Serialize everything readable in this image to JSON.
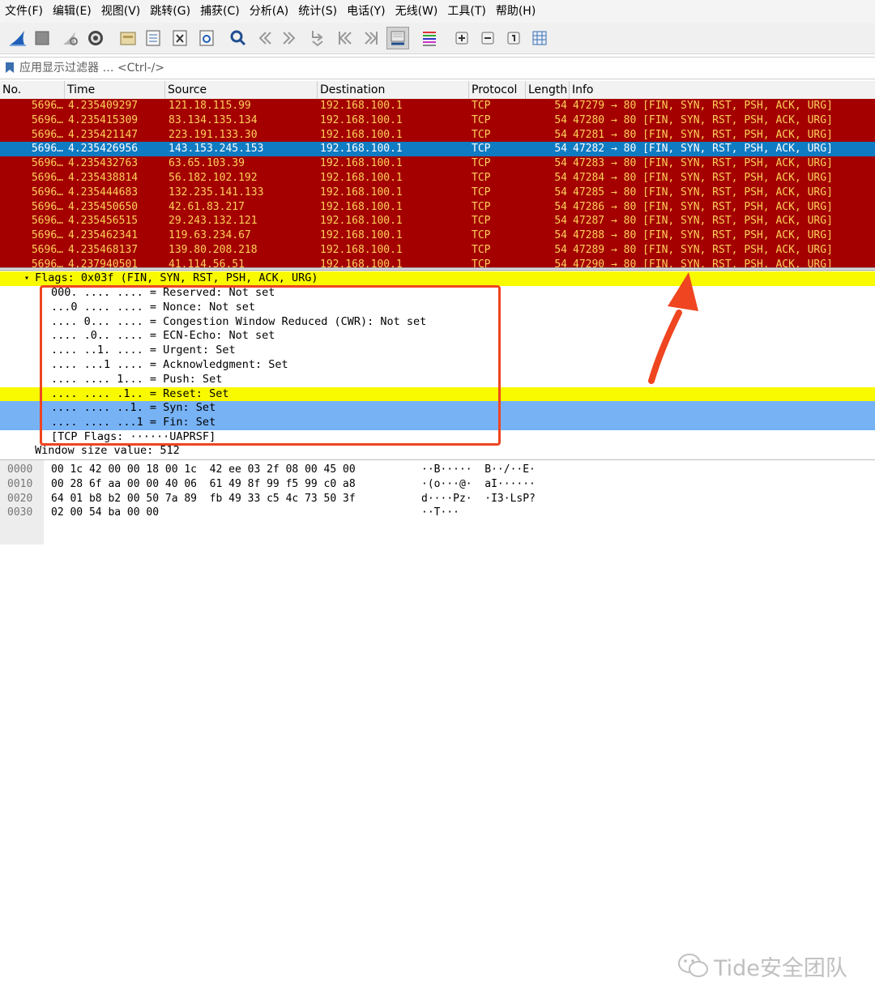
{
  "menu": [
    "文件(F)",
    "编辑(E)",
    "视图(V)",
    "跳转(G)",
    "捕获(C)",
    "分析(A)",
    "统计(S)",
    "电话(Y)",
    "无线(W)",
    "工具(T)",
    "帮助(H)"
  ],
  "filter": {
    "placeholder": "应用显示过滤器 … <Ctrl-/>"
  },
  "columns": [
    "No.",
    "Time",
    "Source",
    "Destination",
    "Protocol",
    "Length",
    "Info"
  ],
  "packets": [
    {
      "no": "5696…",
      "time": "4.235409297",
      "src": "121.18.115.99",
      "dst": "192.168.100.1",
      "proto": "TCP",
      "len": "54",
      "info": "47279 → 80 [FIN, SYN, RST, PSH, ACK, URG]"
    },
    {
      "no": "5696…",
      "time": "4.235415309",
      "src": "83.134.135.134",
      "dst": "192.168.100.1",
      "proto": "TCP",
      "len": "54",
      "info": "47280 → 80 [FIN, SYN, RST, PSH, ACK, URG]"
    },
    {
      "no": "5696…",
      "time": "4.235421147",
      "src": "223.191.133.30",
      "dst": "192.168.100.1",
      "proto": "TCP",
      "len": "54",
      "info": "47281 → 80 [FIN, SYN, RST, PSH, ACK, URG]"
    },
    {
      "no": "5696…",
      "time": "4.235426956",
      "src": "143.153.245.153",
      "dst": "192.168.100.1",
      "proto": "TCP",
      "len": "54",
      "info": "47282 → 80 [FIN, SYN, RST, PSH, ACK, URG]",
      "selected": true
    },
    {
      "no": "5696…",
      "time": "4.235432763",
      "src": "63.65.103.39",
      "dst": "192.168.100.1",
      "proto": "TCP",
      "len": "54",
      "info": "47283 → 80 [FIN, SYN, RST, PSH, ACK, URG]"
    },
    {
      "no": "5696…",
      "time": "4.235438814",
      "src": "56.182.102.192",
      "dst": "192.168.100.1",
      "proto": "TCP",
      "len": "54",
      "info": "47284 → 80 [FIN, SYN, RST, PSH, ACK, URG]"
    },
    {
      "no": "5696…",
      "time": "4.235444683",
      "src": "132.235.141.133",
      "dst": "192.168.100.1",
      "proto": "TCP",
      "len": "54",
      "info": "47285 → 80 [FIN, SYN, RST, PSH, ACK, URG]"
    },
    {
      "no": "5696…",
      "time": "4.235450650",
      "src": "42.61.83.217",
      "dst": "192.168.100.1",
      "proto": "TCP",
      "len": "54",
      "info": "47286 → 80 [FIN, SYN, RST, PSH, ACK, URG]"
    },
    {
      "no": "5696…",
      "time": "4.235456515",
      "src": "29.243.132.121",
      "dst": "192.168.100.1",
      "proto": "TCP",
      "len": "54",
      "info": "47287 → 80 [FIN, SYN, RST, PSH, ACK, URG]"
    },
    {
      "no": "5696…",
      "time": "4.235462341",
      "src": "119.63.234.67",
      "dst": "192.168.100.1",
      "proto": "TCP",
      "len": "54",
      "info": "47288 → 80 [FIN, SYN, RST, PSH, ACK, URG]"
    },
    {
      "no": "5696…",
      "time": "4.235468137",
      "src": "139.80.208.218",
      "dst": "192.168.100.1",
      "proto": "TCP",
      "len": "54",
      "info": "47289 → 80 [FIN, SYN, RST, PSH, ACK, URG]"
    },
    {
      "no": "5696…",
      "time": "4.237940501",
      "src": "41.114.56.51",
      "dst": "192.168.100.1",
      "proto": "TCP",
      "len": "54",
      "info": "47290 → 80 [FIN, SYN, RST, PSH, ACK, URG]"
    }
  ],
  "details": {
    "flags_header": "Flags: 0x03f (FIN, SYN, RST, PSH, ACK, URG)",
    "flag_lines": [
      {
        "text": "000. .... .... = Reserved: Not set"
      },
      {
        "text": "...0 .... .... = Nonce: Not set"
      },
      {
        "text": ".... 0... .... = Congestion Window Reduced (CWR): Not set"
      },
      {
        "text": ".... .0.. .... = ECN-Echo: Not set"
      },
      {
        "text": ".... ..1. .... = Urgent: Set"
      },
      {
        "text": ".... ...1 .... = Acknowledgment: Set"
      },
      {
        "text": ".... .... 1... = Push: Set"
      },
      {
        "text": ".... .... .1.. = Reset: Set",
        "highlight": "yellow"
      },
      {
        "text": ".... .... ..1. = Syn: Set",
        "highlight": "blue"
      },
      {
        "text": ".... .... ...1 = Fin: Set",
        "highlight": "blue"
      },
      {
        "text": "[TCP Flags: ······UAPRSF]"
      }
    ],
    "window_size": "Window size value: 512"
  },
  "bytes": [
    {
      "offset": "0000",
      "hex": "00 1c 42 00 00 18 00 1c  42 ee 03 2f 08 00 45 00",
      "ascii": "··B·····  B··/··E·"
    },
    {
      "offset": "0010",
      "hex": "00 28 6f aa 00 00 40 06  61 49 8f 99 f5 99 c0 a8",
      "ascii": "·(o···@·  aI······"
    },
    {
      "offset": "0020",
      "hex": "64 01 b8 b2 00 50 7a 89  fb 49 33 c5 4c 73 50 3f",
      "ascii": "d····Pz·  ·I3·LsP?"
    },
    {
      "offset": "0030",
      "hex": "02 00 54 ba 00 00",
      "ascii": "··T···"
    }
  ],
  "watermark": "Tide安全团队",
  "colors": {
    "row_bg": "#a40000",
    "row_text": "#fdd05a",
    "selected_bg": "#0f7bc2",
    "highlight_yellow": "#f9f900",
    "highlight_blue": "#77b2f5",
    "annotation": "#ef4520"
  },
  "toolbar_icons": [
    "shark-fin-start-icon",
    "stop-icon",
    "restart-icon",
    "options-gear-icon",
    "open-folder-icon",
    "save-file-icon",
    "close-file-icon",
    "reload-icon",
    "find-magnifier-icon",
    "go-back-icon",
    "go-forward-icon",
    "go-to-packet-icon",
    "go-first-icon",
    "go-last-icon",
    "autoscroll-icon",
    "colorize-icon",
    "zoom-in-icon",
    "zoom-out-icon",
    "normal-size-icon",
    "resize-columns-icon"
  ]
}
